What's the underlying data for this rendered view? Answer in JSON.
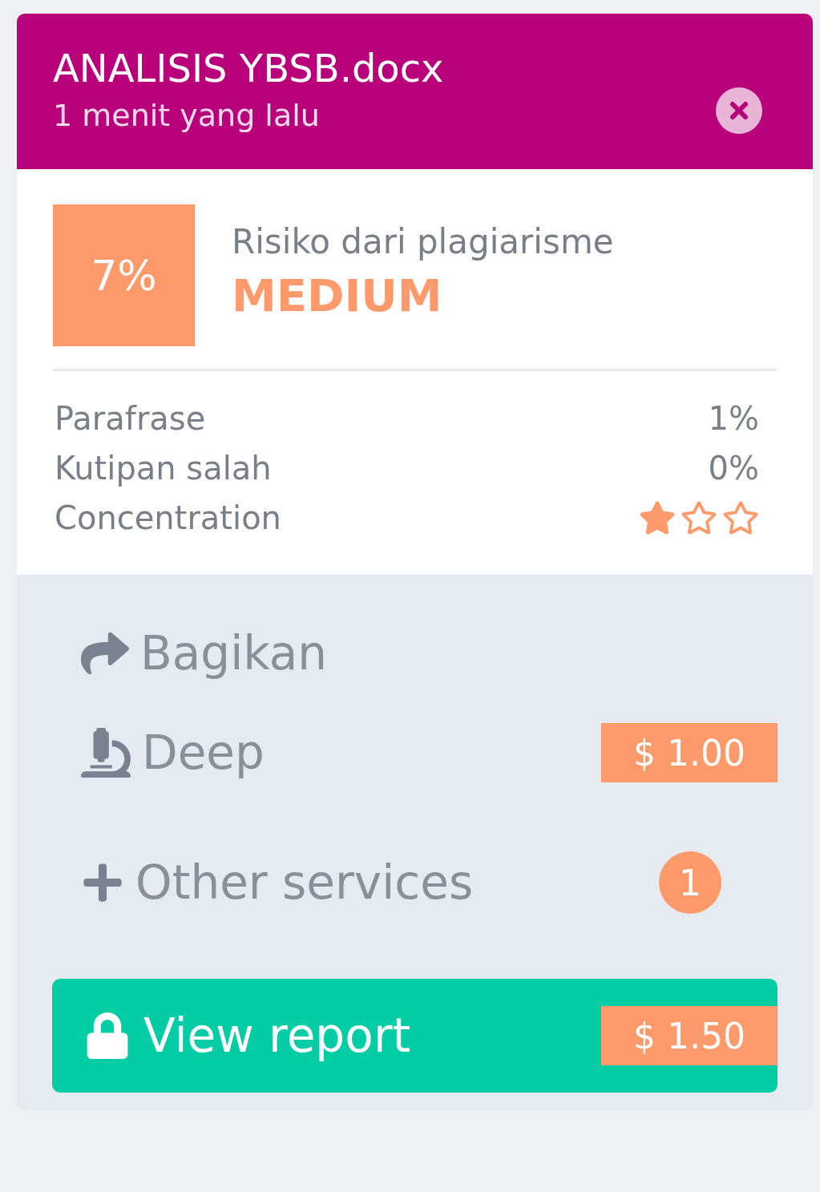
{
  "header": {
    "title": "ANALISIS YBSB.docx",
    "subtitle": "1 menit yang lalu"
  },
  "risk": {
    "score": "7%",
    "label": "Risiko dari plagiarisme",
    "level_text": "MEDIUM"
  },
  "metrics": [
    {
      "kind": "value",
      "label": "Parafrase",
      "value": "1%"
    },
    {
      "kind": "value",
      "label": "Kutipan salah",
      "value": "0%"
    },
    {
      "kind": "stars",
      "label": "Concentration",
      "stars": 1
    }
  ],
  "actions": [
    {
      "kind": "share",
      "label": "Bagikan"
    },
    {
      "kind": "deep",
      "label": "Deep",
      "price": "$ 1.00"
    },
    {
      "kind": "other",
      "label": "Other services",
      "badge": "1"
    }
  ],
  "view_report": {
    "label": "View report",
    "price": "$ 1.50"
  }
}
